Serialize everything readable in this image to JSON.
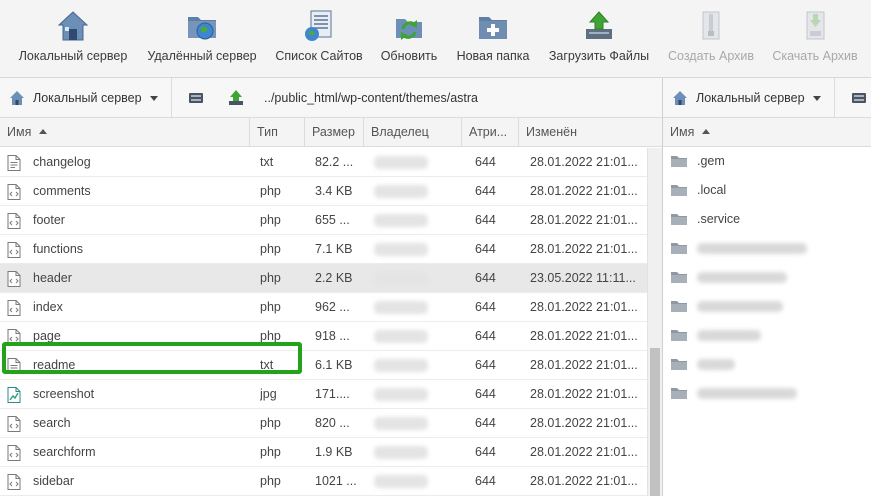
{
  "toolbar": {
    "local_server": "Локальный сервер",
    "remote_server": "Удалённый сервер",
    "site_list": "Список Сайтов",
    "refresh": "Обновить",
    "new_folder": "Новая папка",
    "upload_files": "Загрузить Файлы",
    "create_archive": "Создать Архив",
    "download_archive": "Скачать Архив"
  },
  "left_panel": {
    "server_label": "Локальный сервер",
    "path": "../public_html/wp-content/themes/astra",
    "columns": {
      "name": "Имя",
      "type": "Тип",
      "size": "Размер",
      "owner": "Владелец",
      "attributes": "Атри...",
      "modified": "Изменён"
    },
    "files": [
      {
        "name": "changelog",
        "type": "txt",
        "size": "82.2 ...",
        "attr": "644",
        "modified": "28.01.2022 21:01...",
        "icon": "text-file-icon"
      },
      {
        "name": "comments",
        "type": "php",
        "size": "3.4 KB",
        "attr": "644",
        "modified": "28.01.2022 21:01...",
        "icon": "php-file-icon"
      },
      {
        "name": "footer",
        "type": "php",
        "size": "655 ...",
        "attr": "644",
        "modified": "28.01.2022 21:01...",
        "icon": "php-file-icon"
      },
      {
        "name": "functions",
        "type": "php",
        "size": "7.1 KB",
        "attr": "644",
        "modified": "28.01.2022 21:01...",
        "icon": "php-file-icon"
      },
      {
        "name": "header",
        "type": "php",
        "size": "2.2 KB",
        "attr": "644",
        "modified": "23.05.2022 11:11...",
        "icon": "php-file-icon"
      },
      {
        "name": "index",
        "type": "php",
        "size": "962 ...",
        "attr": "644",
        "modified": "28.01.2022 21:01...",
        "icon": "php-file-icon"
      },
      {
        "name": "page",
        "type": "php",
        "size": "918 ...",
        "attr": "644",
        "modified": "28.01.2022 21:01...",
        "icon": "php-file-icon"
      },
      {
        "name": "readme",
        "type": "txt",
        "size": "6.1 KB",
        "attr": "644",
        "modified": "28.01.2022 21:01...",
        "icon": "text-file-icon"
      },
      {
        "name": "screenshot",
        "type": "jpg",
        "size": "171....",
        "attr": "644",
        "modified": "28.01.2022 21:01...",
        "icon": "image-file-icon"
      },
      {
        "name": "search",
        "type": "php",
        "size": "820 ...",
        "attr": "644",
        "modified": "28.01.2022 21:01...",
        "icon": "php-file-icon"
      },
      {
        "name": "searchform",
        "type": "php",
        "size": "1.9 KB",
        "attr": "644",
        "modified": "28.01.2022 21:01...",
        "icon": "php-file-icon"
      },
      {
        "name": "sidebar",
        "type": "php",
        "size": "1021 ...",
        "attr": "644",
        "modified": "28.01.2022 21:01...",
        "icon": "php-file-icon"
      }
    ]
  },
  "right_panel": {
    "server_label": "Локальный сервер",
    "column_name": "Имя",
    "folders": [
      ".gem",
      ".local",
      ".service"
    ]
  },
  "colors": {
    "highlight": "#22a31b",
    "selected_row": "#e8e8e8"
  }
}
